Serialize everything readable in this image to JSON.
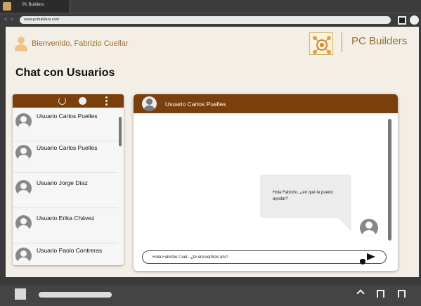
{
  "browser": {
    "tab_title": "Pc Builders",
    "url": "www.pcbuilders.com",
    "back": "<",
    "forward": ">"
  },
  "header": {
    "welcome": "Bienvenido, Fabrizio Cuellar",
    "brand": "PC Builders"
  },
  "page": {
    "title": "Chat con Usuarios"
  },
  "contacts": [
    {
      "name": "Usuario Carlos Puelles"
    },
    {
      "name": "Usuario Carlos Puelles"
    },
    {
      "name": "Usuario Jorge Díaz"
    },
    {
      "name": "Usuario Erika Chávez"
    },
    {
      "name": "Usuario Paolo Contreras"
    }
  ],
  "chat": {
    "contact_name": "Usuario Carlos Puelles",
    "message": "Hola Fabrizio, ¿en qué te puedo ayudar?",
    "input_value": "Hola Fabrizio Cuel...¿te encuentras ahí?"
  },
  "icons": {
    "tab": "pc-builders-logo-icon",
    "user": "user-icon",
    "refresh": "refresh-icon",
    "status": "status-circle-icon",
    "menu": "more-vertical-icon",
    "send": "send-icon",
    "cursor": "hand-cursor-icon"
  },
  "colors": {
    "brand": "#9c6b2e",
    "header_bar": "#7a3f0a",
    "page_bg": "#f3efe6"
  }
}
